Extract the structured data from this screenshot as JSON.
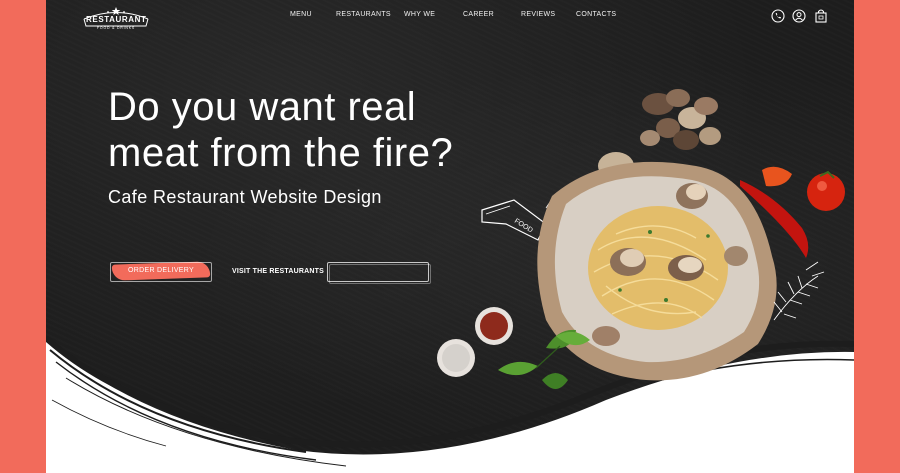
{
  "header": {
    "logo_title": "RESTAURANT",
    "logo_subtitle": "FOOD & DRINKS",
    "nav": [
      {
        "label": "MENU"
      },
      {
        "label": "RESTAURANTS"
      },
      {
        "label": "WHY WE"
      },
      {
        "label": "CAREER"
      },
      {
        "label": "REVIEWS"
      },
      {
        "label": "CONTACTS"
      }
    ],
    "icons": [
      "phone-icon",
      "user-icon",
      "shopping-bag-icon"
    ]
  },
  "hero": {
    "title_line1": "Do you want real",
    "title_line2": "meat from the fire?",
    "subtitle": "Cafe Restaurant Website Design",
    "order_button": "ORDER DELIVERY",
    "visit_link": "VISIT THE RESTAURANTS",
    "ribbon_text": "FOOD"
  },
  "colors": {
    "accent": "#f26b5b",
    "board": "#1d1d1d",
    "text": "#ffffff"
  }
}
